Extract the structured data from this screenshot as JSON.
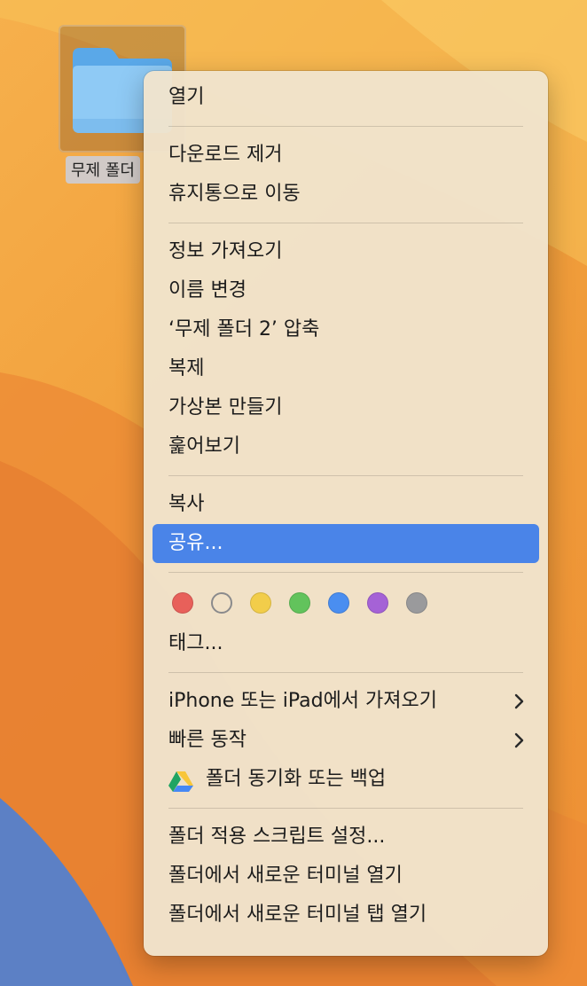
{
  "desktop": {
    "folder_label": "무제 폴더",
    "colors": {
      "folder_light": "#8fcaf5",
      "folder_dark": "#5aa8e8",
      "selection": "rgba(120,80,40,0.35)"
    }
  },
  "menu": {
    "colors": {
      "background": "#f0e4cd",
      "highlight": "#4a84e8",
      "text": "#1c1c1c"
    },
    "items": {
      "open": "열기",
      "remove_download": "다운로드 제거",
      "move_to_trash": "휴지통으로 이동",
      "get_info": "정보 가져오기",
      "rename": "이름 변경",
      "compress": "‘무제 폴더 2’ 압축",
      "duplicate": "복제",
      "make_alias": "가상본 만들기",
      "quick_look": "훑어보기",
      "copy": "복사",
      "share": "공유...",
      "tags": "태그...",
      "import_from_iphone": "iPhone 또는 iPad에서 가져오기",
      "quick_actions": "빠른 동작",
      "google_drive_sync": "폴더 동기화 또는 백업",
      "folder_actions_setup": "폴더 적용 스크립트 설정...",
      "new_terminal": "폴더에서 새로운 터미널 열기",
      "new_terminal_tab": "폴더에서 새로운 터미널 탭 열기"
    },
    "highlighted_item": "share",
    "tag_colors": [
      {
        "name": "red",
        "hex": "#e8605a"
      },
      {
        "name": "none",
        "hex": "#ffffff"
      },
      {
        "name": "yellow",
        "hex": "#f2cd4a"
      },
      {
        "name": "green",
        "hex": "#62c35c"
      },
      {
        "name": "blue",
        "hex": "#4a8ef0"
      },
      {
        "name": "purple",
        "hex": "#a562d6"
      },
      {
        "name": "gray",
        "hex": "#9a9a9c"
      }
    ],
    "icons": {
      "submenu": "chevron-right-icon",
      "google_drive": "google-drive-icon"
    }
  }
}
